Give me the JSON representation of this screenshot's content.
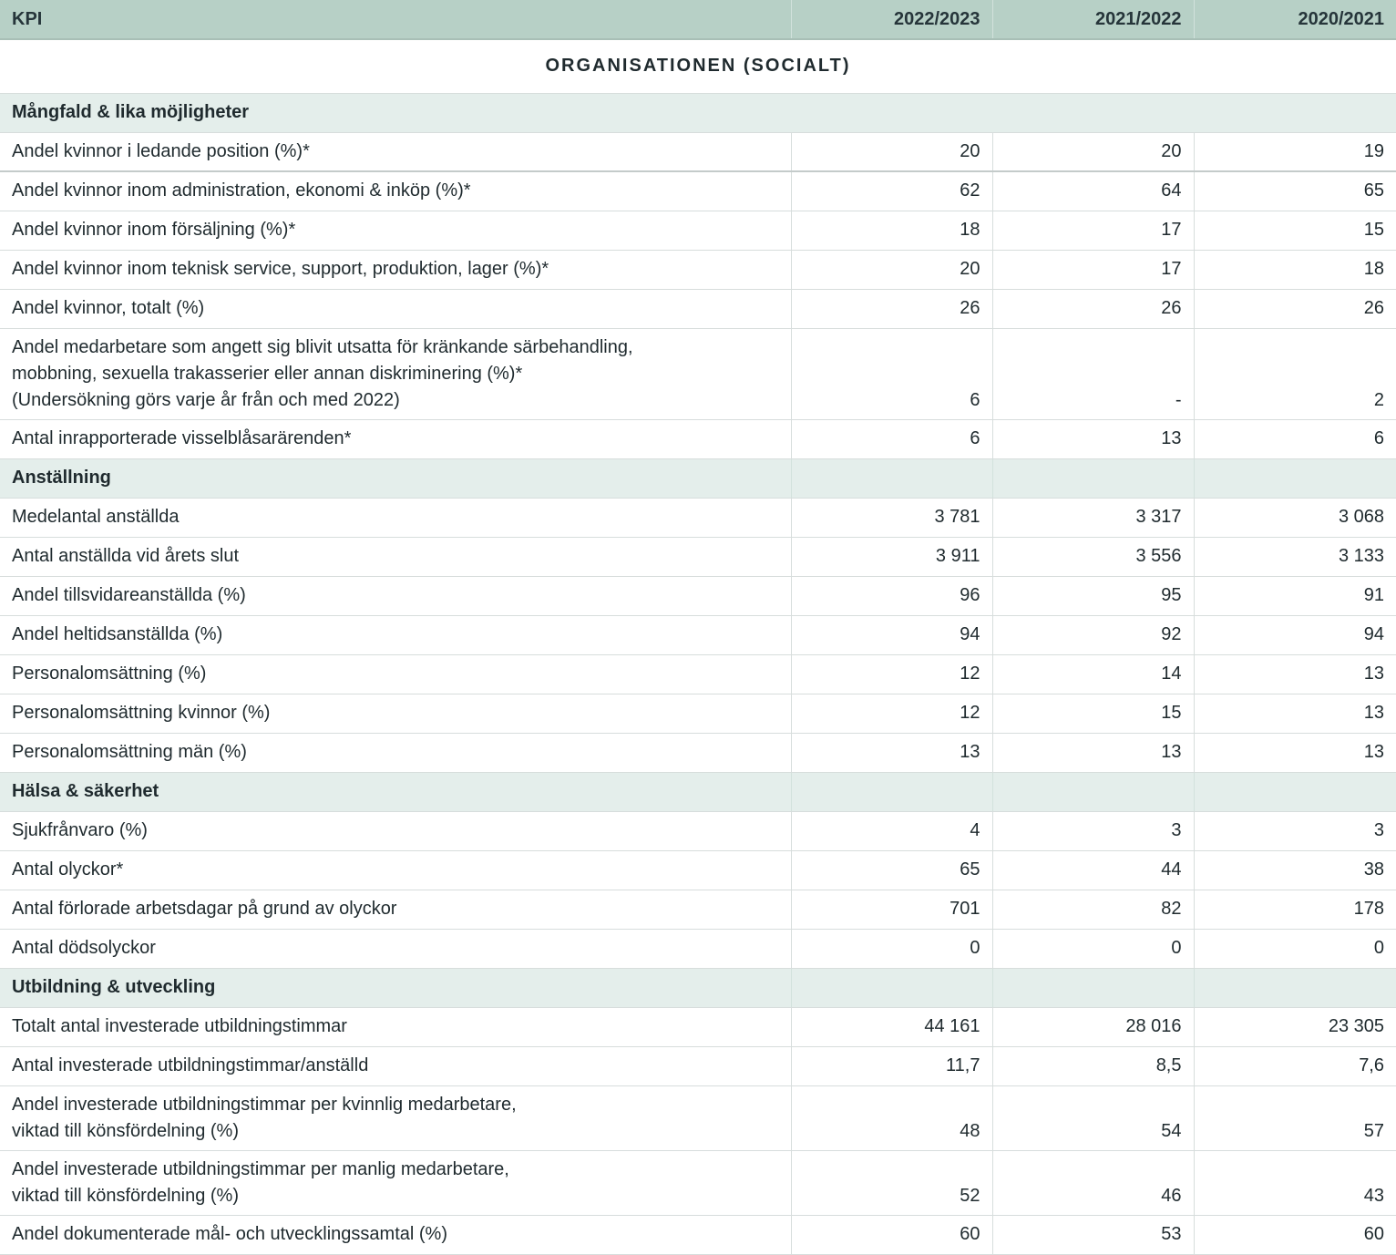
{
  "header": {
    "kpi_label": "KPI",
    "years": [
      "2022/2023",
      "2021/2022",
      "2020/2021"
    ]
  },
  "title": "ORGANISATIONEN (SOCIALT)",
  "sections": [
    {
      "name": "Mångfald & lika möjligheter",
      "rows": [
        {
          "label": "Andel kvinnor i ledande position (%)*",
          "values": [
            "20",
            "20",
            "19"
          ]
        },
        {
          "label": "Andel kvinnor inom administration, ekonomi & inköp (%)*",
          "values": [
            "62",
            "64",
            "65"
          ]
        },
        {
          "label": "Andel kvinnor inom försäljning (%)*",
          "values": [
            "18",
            "17",
            "15"
          ]
        },
        {
          "label": "Andel kvinnor inom teknisk service, support, produktion, lager (%)*",
          "values": [
            "20",
            "17",
            "18"
          ]
        },
        {
          "label": "Andel kvinnor, totalt (%)",
          "values": [
            "26",
            "26",
            "26"
          ]
        },
        {
          "label": "Andel medarbetare som angett sig blivit utsatta för kränkande särbehandling, mobbning, sexuella trakasserier eller annan diskriminering (%)* (Undersökning görs varje år från och med 2022)",
          "lines": [
            "Andel medarbetare som angett sig blivit utsatta för kränkande särbehandling,",
            "mobbning, sexuella trakasserier eller annan diskriminering (%)*",
            "(Undersökning görs varje år från och med 2022)"
          ],
          "values": [
            "6",
            "-",
            "2"
          ]
        },
        {
          "label": "Antal inrapporterade visselblåsarärenden*",
          "values": [
            "6",
            "13",
            "6"
          ]
        }
      ]
    },
    {
      "name": "Anställning",
      "rows": [
        {
          "label": "Medelantal anställda",
          "values": [
            "3 781",
            "3 317",
            "3 068"
          ]
        },
        {
          "label": "Antal anställda vid årets slut",
          "values": [
            "3 911",
            "3 556",
            "3 133"
          ]
        },
        {
          "label": "Andel tillsvidareanställda (%)",
          "values": [
            "96",
            "95",
            "91"
          ]
        },
        {
          "label": "Andel heltidsanställda (%)",
          "values": [
            "94",
            "92",
            "94"
          ]
        },
        {
          "label": "Personalomsättning (%)",
          "values": [
            "12",
            "14",
            "13"
          ]
        },
        {
          "label": "Personalomsättning kvinnor (%)",
          "values": [
            "12",
            "15",
            "13"
          ]
        },
        {
          "label": "Personalomsättning män (%)",
          "values": [
            "13",
            "13",
            "13"
          ]
        }
      ]
    },
    {
      "name": "Hälsa & säkerhet",
      "rows": [
        {
          "label": "Sjukfrånvaro (%)",
          "values": [
            "4",
            "3",
            "3"
          ]
        },
        {
          "label": "Antal olyckor*",
          "values": [
            "65",
            "44",
            "38"
          ]
        },
        {
          "label": "Antal förlorade arbetsdagar på grund av olyckor",
          "values": [
            "701",
            "82",
            "178"
          ]
        },
        {
          "label": "Antal dödsolyckor",
          "values": [
            "0",
            "0",
            "0"
          ]
        }
      ]
    },
    {
      "name": "Utbildning & utveckling",
      "rows": [
        {
          "label": "Totalt antal investerade utbildningstimmar",
          "values": [
            "44 161",
            "28 016",
            "23 305"
          ]
        },
        {
          "label": "Antal investerade utbildningstimmar/anställd",
          "values": [
            "11,7",
            "8,5",
            "7,6"
          ]
        },
        {
          "label": "Andel investerade utbildningstimmar per kvinnlig medarbetare, viktad till könsfördelning (%)",
          "lines": [
            "Andel investerade utbildningstimmar per kvinnlig medarbetare,",
            "viktad till könsfördelning (%)"
          ],
          "values": [
            "48",
            "54",
            "57"
          ]
        },
        {
          "label": "Andel investerade utbildningstimmar per manlig medarbetare, viktad till könsfördelning (%)",
          "lines": [
            "Andel investerade utbildningstimmar per manlig medarbetare,",
            "viktad till könsfördelning (%)"
          ],
          "values": [
            "52",
            "46",
            "43"
          ]
        },
        {
          "label": "Andel dokumenterade mål- och utvecklingssamtal (%)",
          "values": [
            "60",
            "53",
            "60"
          ]
        }
      ]
    }
  ]
}
